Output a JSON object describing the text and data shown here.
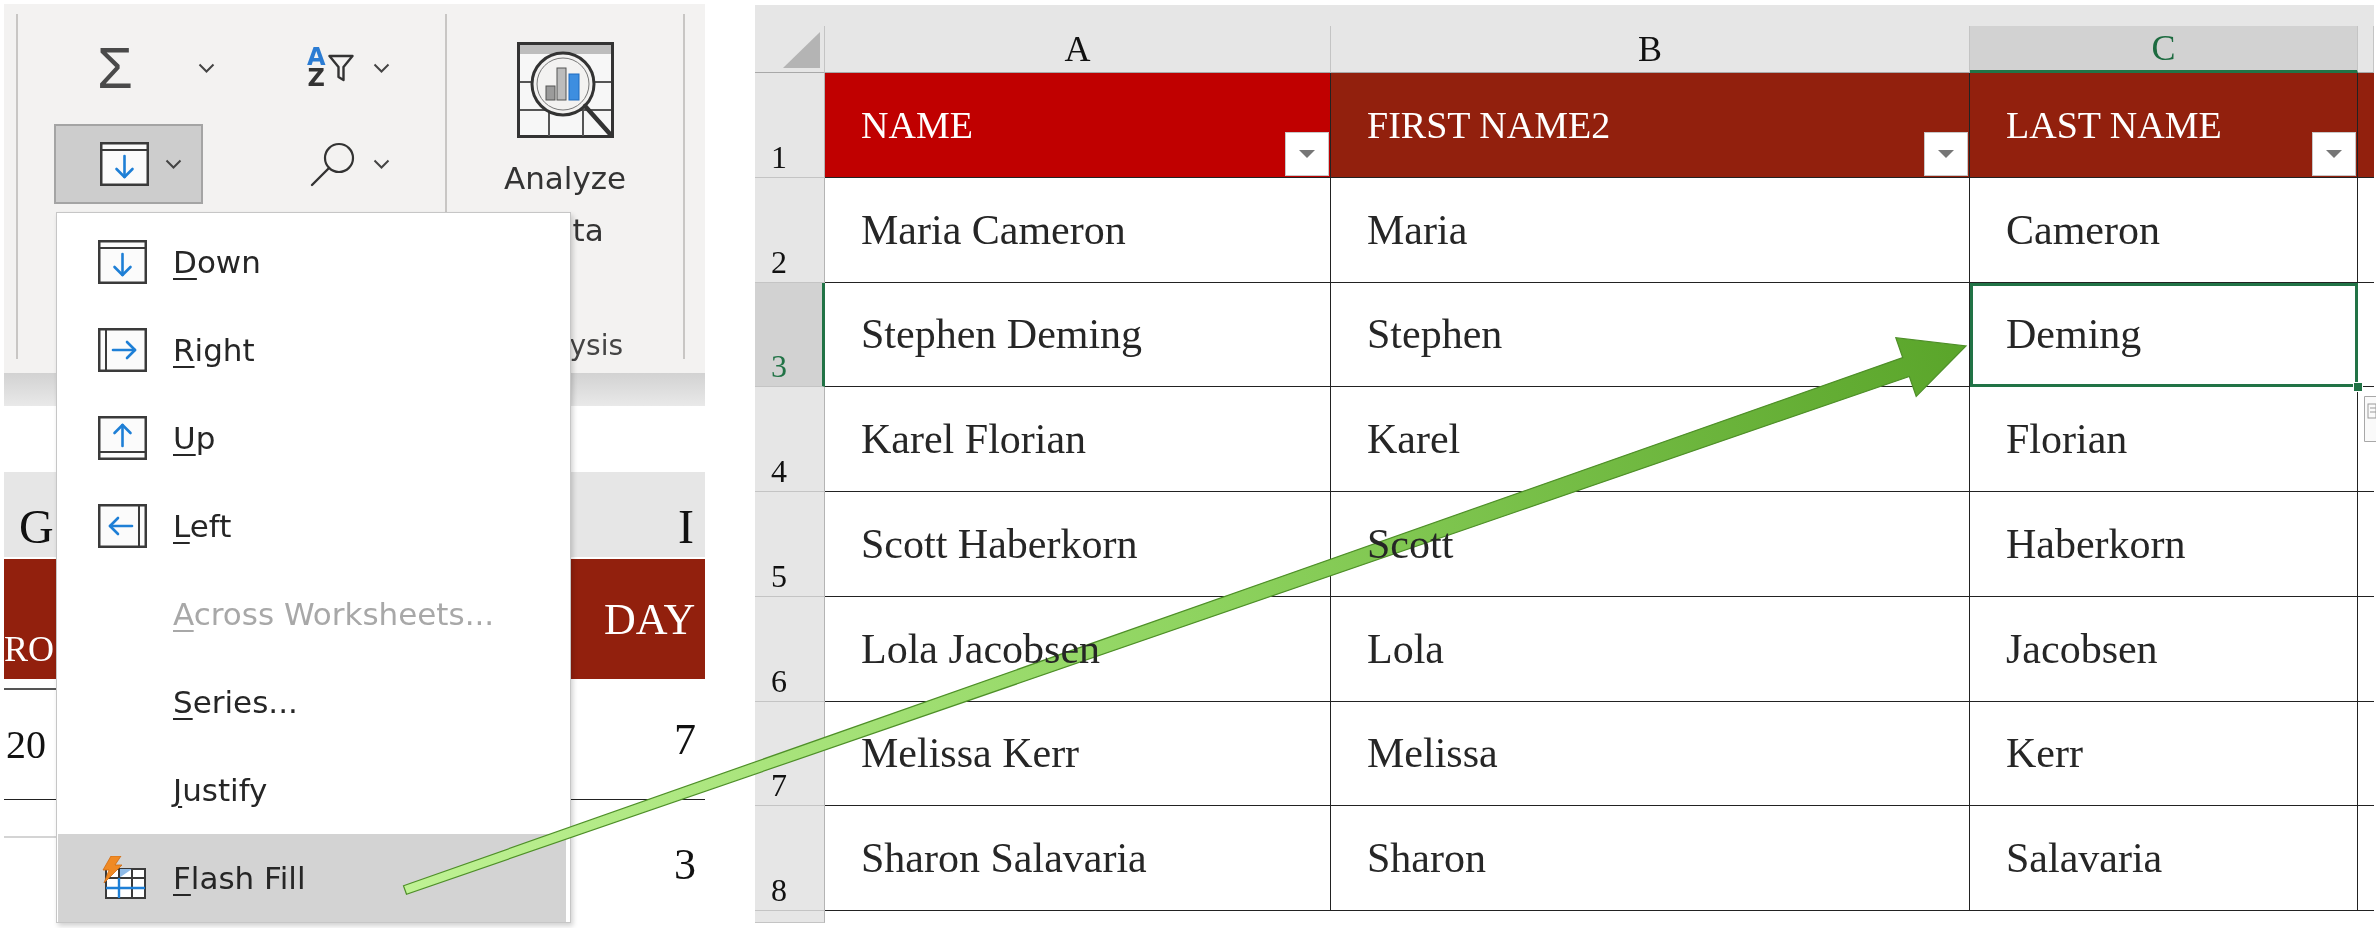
{
  "ribbon": {
    "buttons": [
      {
        "kind": "sum",
        "symbol": "Σ",
        "pressed": false
      },
      {
        "kind": "sort",
        "glyphs": [
          "A",
          "Z"
        ],
        "pressed": false
      },
      {
        "kind": "fill",
        "pressed": true
      },
      {
        "kind": "find",
        "pressed": false
      }
    ],
    "analyze_button": {
      "lines": [
        "Analyze",
        "ta"
      ]
    },
    "group_label": "ysis"
  },
  "fill_menu": {
    "items": [
      {
        "label": "Down",
        "kind": "down",
        "disabled": false,
        "selected": false
      },
      {
        "label": "Right",
        "kind": "right",
        "disabled": false,
        "selected": false
      },
      {
        "label": "Up",
        "kind": "up",
        "disabled": false,
        "selected": false
      },
      {
        "label": "Left",
        "kind": "left",
        "disabled": false,
        "selected": false
      },
      {
        "label": "Across Worksheets...",
        "kind": "plain",
        "disabled": true,
        "selected": false
      },
      {
        "label": "Series...",
        "kind": "plain",
        "disabled": false,
        "selected": false
      },
      {
        "label": "Justify",
        "kind": "plain",
        "disabled": false,
        "selected": false
      },
      {
        "label": "Flash Fill",
        "kind": "flash",
        "disabled": false,
        "selected": true
      }
    ]
  },
  "background_sheet": {
    "columns": [
      "G",
      "I"
    ],
    "header": [
      "RO",
      "DAY"
    ],
    "rows": [
      {
        "col_g": "20",
        "col_i": "7"
      },
      {
        "col_i": "3"
      }
    ]
  },
  "sheet": {
    "columns": [
      {
        "letter": "A",
        "selected": false
      },
      {
        "letter": "B",
        "selected": false
      },
      {
        "letter": "C",
        "selected": true
      }
    ],
    "header_row": {
      "number": "1",
      "selected": false,
      "cells": [
        {
          "text": "NAME",
          "color": "#c00000"
        },
        {
          "text": "FIRST NAME2",
          "color": "#92200d"
        },
        {
          "text": "LAST NAME",
          "color": "#92200d"
        }
      ]
    },
    "rows": [
      {
        "number": "2",
        "selected": false,
        "cells": [
          {
            "text": "Maria Cameron",
            "active": false
          },
          {
            "text": "Maria",
            "active": false
          },
          {
            "text": "Cameron",
            "active": false
          }
        ]
      },
      {
        "number": "3",
        "selected": true,
        "cells": [
          {
            "text": "Stephen Deming",
            "active": false
          },
          {
            "text": "Stephen",
            "active": false
          },
          {
            "text": "Deming",
            "active": true
          }
        ]
      },
      {
        "number": "4",
        "selected": false,
        "cells": [
          {
            "text": "Karel Florian",
            "active": false
          },
          {
            "text": "Karel",
            "active": false
          },
          {
            "text": "Florian",
            "active": false
          }
        ]
      },
      {
        "number": "5",
        "selected": false,
        "cells": [
          {
            "text": "Scott Haberkorn",
            "active": false
          },
          {
            "text": "Scott",
            "active": false
          },
          {
            "text": "Haberkorn",
            "active": false
          }
        ]
      },
      {
        "number": "6",
        "selected": false,
        "cells": [
          {
            "text": "Lola Jacobsen",
            "active": false
          },
          {
            "text": "Lola",
            "active": false
          },
          {
            "text": "Jacobsen",
            "active": false
          }
        ]
      },
      {
        "number": "7",
        "selected": false,
        "cells": [
          {
            "text": "Melissa Kerr",
            "active": false
          },
          {
            "text": "Melissa",
            "active": false
          },
          {
            "text": "Kerr",
            "active": false
          }
        ]
      },
      {
        "number": "8",
        "selected": false,
        "cells": [
          {
            "text": "Sharon Salavaria",
            "active": false
          },
          {
            "text": "Sharon",
            "active": false
          },
          {
            "text": "Salavaria",
            "active": false
          }
        ]
      }
    ]
  }
}
